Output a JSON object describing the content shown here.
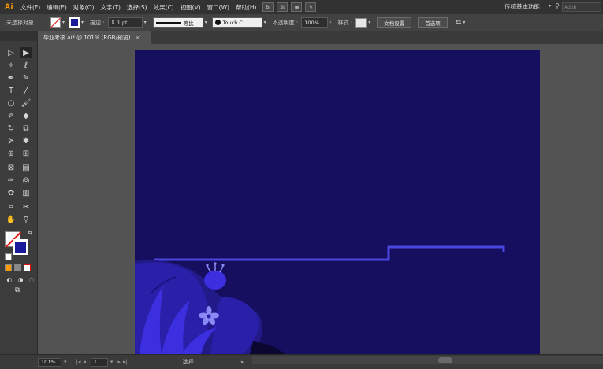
{
  "app": {
    "logo": "Ai",
    "workspace": "传统基本功能",
    "search_placeholder": "Adob"
  },
  "menus": [
    "文件(F)",
    "编辑(E)",
    "对象(O)",
    "文字(T)",
    "选择(S)",
    "效果(C)",
    "视图(V)",
    "窗口(W)",
    "帮助(H)"
  ],
  "menubar_buttons": [
    "Br",
    "St"
  ],
  "control": {
    "selection_label": "未选择对象",
    "stroke_label": "描边 :",
    "stroke_weight": "1 pt",
    "stroke_profile": "等比",
    "brush": "Touch C...",
    "opacity_label": "不透明度 :",
    "opacity": "100%",
    "style_label": "样式 :",
    "doc_setup": "文档设置",
    "preferences": "首选项"
  },
  "tab": {
    "title": "毕业考核.ai* @ 101% (RGB/预览)",
    "close": "×"
  },
  "status": {
    "zoom": "101%",
    "artboard": "1",
    "tool": "选择"
  },
  "colors": {
    "artboard_bg": "#160e5e",
    "accent_line": "#4a45e0",
    "leaf_dark": "#2a1fa8",
    "leaf_bright": "#3b2fe0",
    "flower": "#8a8af5",
    "ai_orange": "#ff9a00"
  },
  "icons": [
    "selection-tool",
    "direct-selection-tool",
    "magic-wand",
    "lasso",
    "pen",
    "curvature",
    "type",
    "line-segment",
    "ellipse",
    "paintbrush",
    "shaper",
    "eraser",
    "rotate",
    "scale",
    "width",
    "puppet-warp",
    "shape-builder",
    "perspective-grid",
    "mesh",
    "gradient",
    "eyedropper",
    "blend",
    "symbol-sprayer",
    "column-graph",
    "artboard",
    "slice",
    "hand",
    "zoom"
  ]
}
